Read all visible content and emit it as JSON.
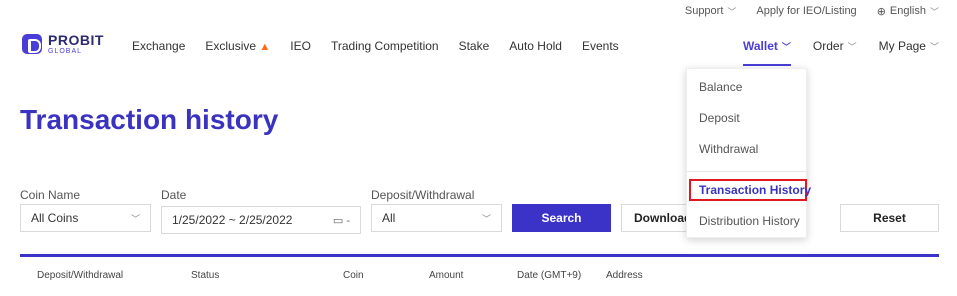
{
  "topbar": {
    "support": "Support",
    "apply": "Apply for IEO/Listing",
    "language": "English"
  },
  "logo": {
    "main": "PROBIT",
    "sub": "GLOBAL"
  },
  "nav": {
    "links": [
      "Exchange",
      "Exclusive",
      "IEO",
      "Trading Competition",
      "Stake",
      "Auto Hold",
      "Events"
    ],
    "right": [
      "Wallet",
      "Order",
      "My Page"
    ]
  },
  "page": {
    "title": "Transaction history"
  },
  "filters": {
    "coin_label": "Coin Name",
    "coin_value": "All Coins",
    "date_label": "Date",
    "date_value": "1/25/2022 ~ 2/25/2022",
    "type_label": "Deposit/Withdrawal",
    "type_value": "All",
    "search": "Search",
    "download": "Download CSV",
    "reset": "Reset"
  },
  "table": {
    "columns": [
      "Deposit/Withdrawal",
      "Status",
      "Coin",
      "Amount",
      "Date (GMT+9)",
      "Address"
    ]
  },
  "wallet_menu": {
    "items": [
      "Balance",
      "Deposit",
      "Withdrawal",
      "Transaction History",
      "Distribution History"
    ],
    "selected": "Transaction History"
  },
  "colors": {
    "brand": "#3b32c8",
    "highlight": "#e0181f",
    "fire": "#ff6a1a"
  }
}
